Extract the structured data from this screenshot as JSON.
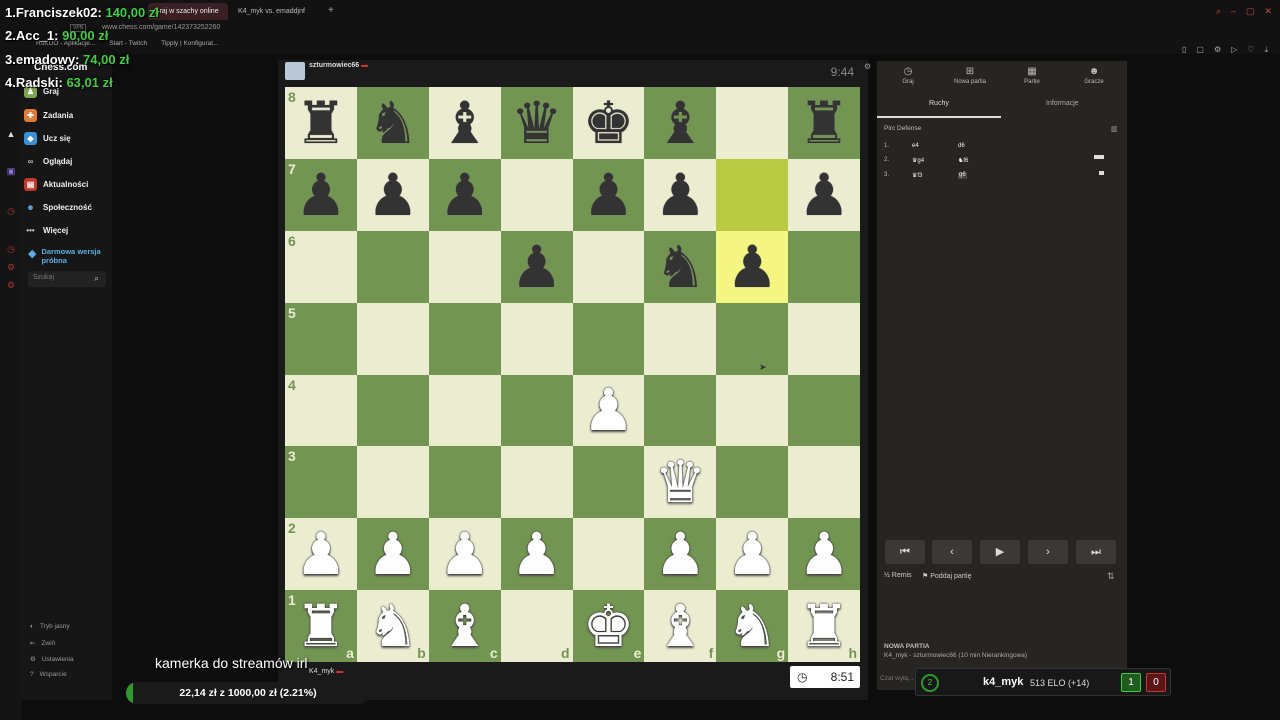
{
  "browser": {
    "tabs": [
      {
        "label": "Graj w szachy online",
        "active": true
      },
      {
        "label": "K4_myk vs. emaddjnf",
        "active": false
      }
    ],
    "new_tab": "+",
    "url": "www.chess.com/game/142373252260",
    "vpn": "VPN",
    "bookmarks": [
      "RoKUO - Aplikacje...",
      "Start - Twitch",
      "Tipply | Konfigurat..."
    ]
  },
  "donors": [
    {
      "rank_name": "1.Franciszek02:",
      "amount": "140,00 zł"
    },
    {
      "rank_name": "2.Acc_1:",
      "amount": "90,00 zł"
    },
    {
      "rank_name": "3.emadowy:",
      "amount": "74,00 zł"
    },
    {
      "rank_name": "4.Radski:",
      "amount": "63,01 zł"
    }
  ],
  "sidebar": {
    "logo": "Chess.com",
    "items": [
      {
        "label": "Graj",
        "icon": "pawn-icon",
        "color": "#7fa650"
      },
      {
        "label": "Zadania",
        "icon": "puzzle-icon",
        "color": "#e07b39"
      },
      {
        "label": "Ucz się",
        "icon": "learn-icon",
        "color": "#3a8fd6"
      },
      {
        "label": "Oglądaj",
        "icon": "binoculars-icon",
        "color": "#999999"
      },
      {
        "label": "Aktualności",
        "icon": "news-icon",
        "color": "#c0392b"
      },
      {
        "label": "Społeczność",
        "icon": "community-icon",
        "color": "#5dade2"
      },
      {
        "label": "Więcej",
        "icon": "more-icon",
        "color": "#cccccc"
      }
    ],
    "trial_label": "Darmowa wersja próbna",
    "search_placeholder": "Szukaj",
    "footer": [
      "Tryb jasny",
      "Zwiń",
      "Ustawienia",
      "Wsparcie"
    ]
  },
  "game": {
    "opponent": "szturmowiec66",
    "opponent_clock": "9:44",
    "player": "K4_myk",
    "player_clock": "8:51",
    "ranks": [
      "8",
      "7",
      "6",
      "5",
      "4",
      "3",
      "2",
      "1"
    ],
    "files": [
      "a",
      "b",
      "c",
      "d",
      "e",
      "f",
      "g",
      "h"
    ],
    "board": [
      [
        "br",
        "bn",
        "bb",
        "bq",
        "bk",
        "bb",
        "",
        "br"
      ],
      [
        "bp",
        "bp",
        "bp",
        "",
        "bp",
        "bp",
        "",
        "bp"
      ],
      [
        "",
        "",
        "",
        "bp",
        "",
        "bn",
        "bp",
        ""
      ],
      [
        "",
        "",
        "",
        "",
        "",
        "",
        "",
        ""
      ],
      [
        "",
        "",
        "",
        "",
        "wp",
        "",
        "",
        ""
      ],
      [
        "",
        "",
        "",
        "",
        "",
        "wq",
        "",
        ""
      ],
      [
        "wp",
        "wp",
        "wp",
        "wp",
        "",
        "wp",
        "wp",
        "wp"
      ],
      [
        "wr",
        "wn",
        "wb",
        "",
        "wk",
        "wb",
        "wn",
        "wr"
      ]
    ],
    "highlights": [
      [
        1,
        6
      ],
      [
        2,
        6
      ]
    ]
  },
  "panel": {
    "tabs": [
      {
        "label": "Graj",
        "icon": "clock-icon"
      },
      {
        "label": "Nowa partia",
        "icon": "plus-icon"
      },
      {
        "label": "Partie",
        "icon": "grid-icon"
      },
      {
        "label": "Gracze",
        "icon": "users-icon"
      }
    ],
    "subtabs": [
      "Ruchy",
      "Informacje"
    ],
    "opening": "Pirc Defense",
    "moves": [
      {
        "num": "1.",
        "white": "e4",
        "black": "d6"
      },
      {
        "num": "2.",
        "white": "♛g4",
        "black": "♞f6"
      },
      {
        "num": "3.",
        "white": "♛f3",
        "black": "g6"
      }
    ],
    "actions": [
      "Remis",
      "Poddaj partię"
    ],
    "new_game_title": "NOWA PARTIA",
    "new_game_desc": "K4_myk - szturmowiec66 (10 min Nierankingowa)",
    "chat_placeholder": "Czat wyłą..."
  },
  "stream": {
    "camera_text": "kamerka do streamów irl",
    "goal_text": "22,14 zł z 1000,00 zł (2.21%)",
    "goal_fraction": 0.0221,
    "elo_name": "k4_myk",
    "elo_text": "513 ELO (+14)",
    "streak": "2",
    "wins": "1",
    "losses": "0"
  }
}
